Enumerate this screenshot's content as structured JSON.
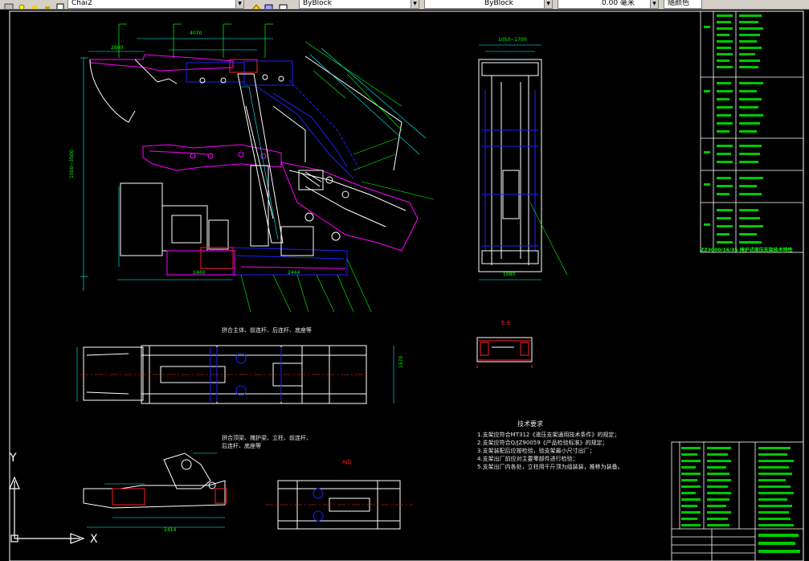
{
  "toolbar": {
    "layer_combo": "Chai2",
    "linetype_combo": "ByBlock",
    "lineweight_combo": "ByBlock",
    "scale_combo": "0.00 毫米",
    "plotstyle_combo": "随颜色"
  },
  "drawing": {
    "title_block_caption": "ZZ3000/16/35 掩护式液压支架技术特性",
    "section_label": "E-E",
    "view_label_top": "拼合主体、前连杆、后连杆、底座等",
    "view_label_bottom_1": "拼合顶梁、掩护梁、立柱、前连杆、",
    "view_label_bottom_2": "后连杆、底座等",
    "detail_label": "A向",
    "tech_req_title": "技术要求",
    "tech_req_lines": [
      "1.支架应符合MT312《液压支架通用技术条件》的规定；",
      "2.支架应符合Q/JZ90059《产品检验标准》的规定；",
      "3.支架装配后应按检验，验支架最小尺寸出厂；",
      "4.支架出厂前应对主要零部件进行检验；",
      "5.支架出厂内各处，立柱用千斤顶为组装装，推移为装备。"
    ]
  },
  "dimensions": {
    "top_width": "4070",
    "top_left": "2800",
    "height_range": "1500~3500",
    "plan_width": "1050~1700",
    "plan_depth": "1680",
    "base_len": "2444",
    "base_width": "1440",
    "bottom_len": "2414",
    "plan_view_height": "1570"
  },
  "ucs": {
    "y_label": "Y",
    "x_label": "X"
  },
  "colors": {
    "magenta": "#ff00ff",
    "blue": "#2020ff",
    "white": "#ffffff",
    "red": "#ff2020",
    "green": "#00ff00",
    "cyan": "#00ffff",
    "yellow": "#ffff00"
  }
}
